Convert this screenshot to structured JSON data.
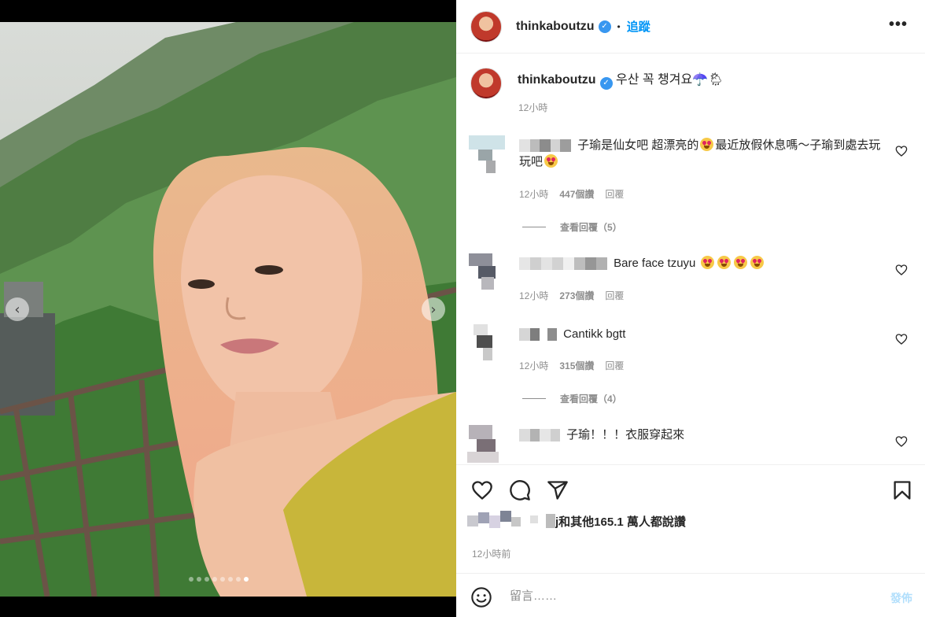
{
  "post": {
    "username": "thinkaboutzu",
    "follow_label": "追蹤",
    "separator": "•",
    "more_label": "•••",
    "verified_glyph": "✓",
    "caption": "우산 꼭 챙겨요☂️🌦",
    "caption_time": "12小時"
  },
  "media": {
    "prev_icon": "‹",
    "next_icon": "›",
    "slide_count": 8,
    "active_slide": 8
  },
  "comments": [
    {
      "text_a": "子瑜是仙女吧 超漂亮的",
      "text_b": "最近放假休息嗎～子瑜到處去玩玩吧",
      "time": "12小時",
      "likes": "447個讚",
      "reply": "回覆",
      "view_replies": "查看回覆（5）"
    },
    {
      "text": "Bare face tzuyu",
      "time": "12小時",
      "likes": "273個讚",
      "reply": "回覆"
    },
    {
      "text": "Cantikk bgtt",
      "time": "12小時",
      "likes": "315個讚",
      "reply": "回覆",
      "view_replies": "查看回覆（4）"
    },
    {
      "text": "子瑜！！！衣服穿起來"
    }
  ],
  "likes_summary": {
    "text": "j和其他165.1 萬人都說讚"
  },
  "post_time": "12小時前",
  "composer": {
    "placeholder": "留言……",
    "post_label": "發佈"
  },
  "icons": {
    "like": "heart-icon",
    "comment": "comment-icon",
    "share": "send-icon",
    "save": "bookmark-icon",
    "emoji": "smiley-icon"
  },
  "colors": {
    "accent": "#0095f6",
    "verified": "#3897f0",
    "muted": "#8e8e8e",
    "post_disabled": "#b2dffc"
  }
}
